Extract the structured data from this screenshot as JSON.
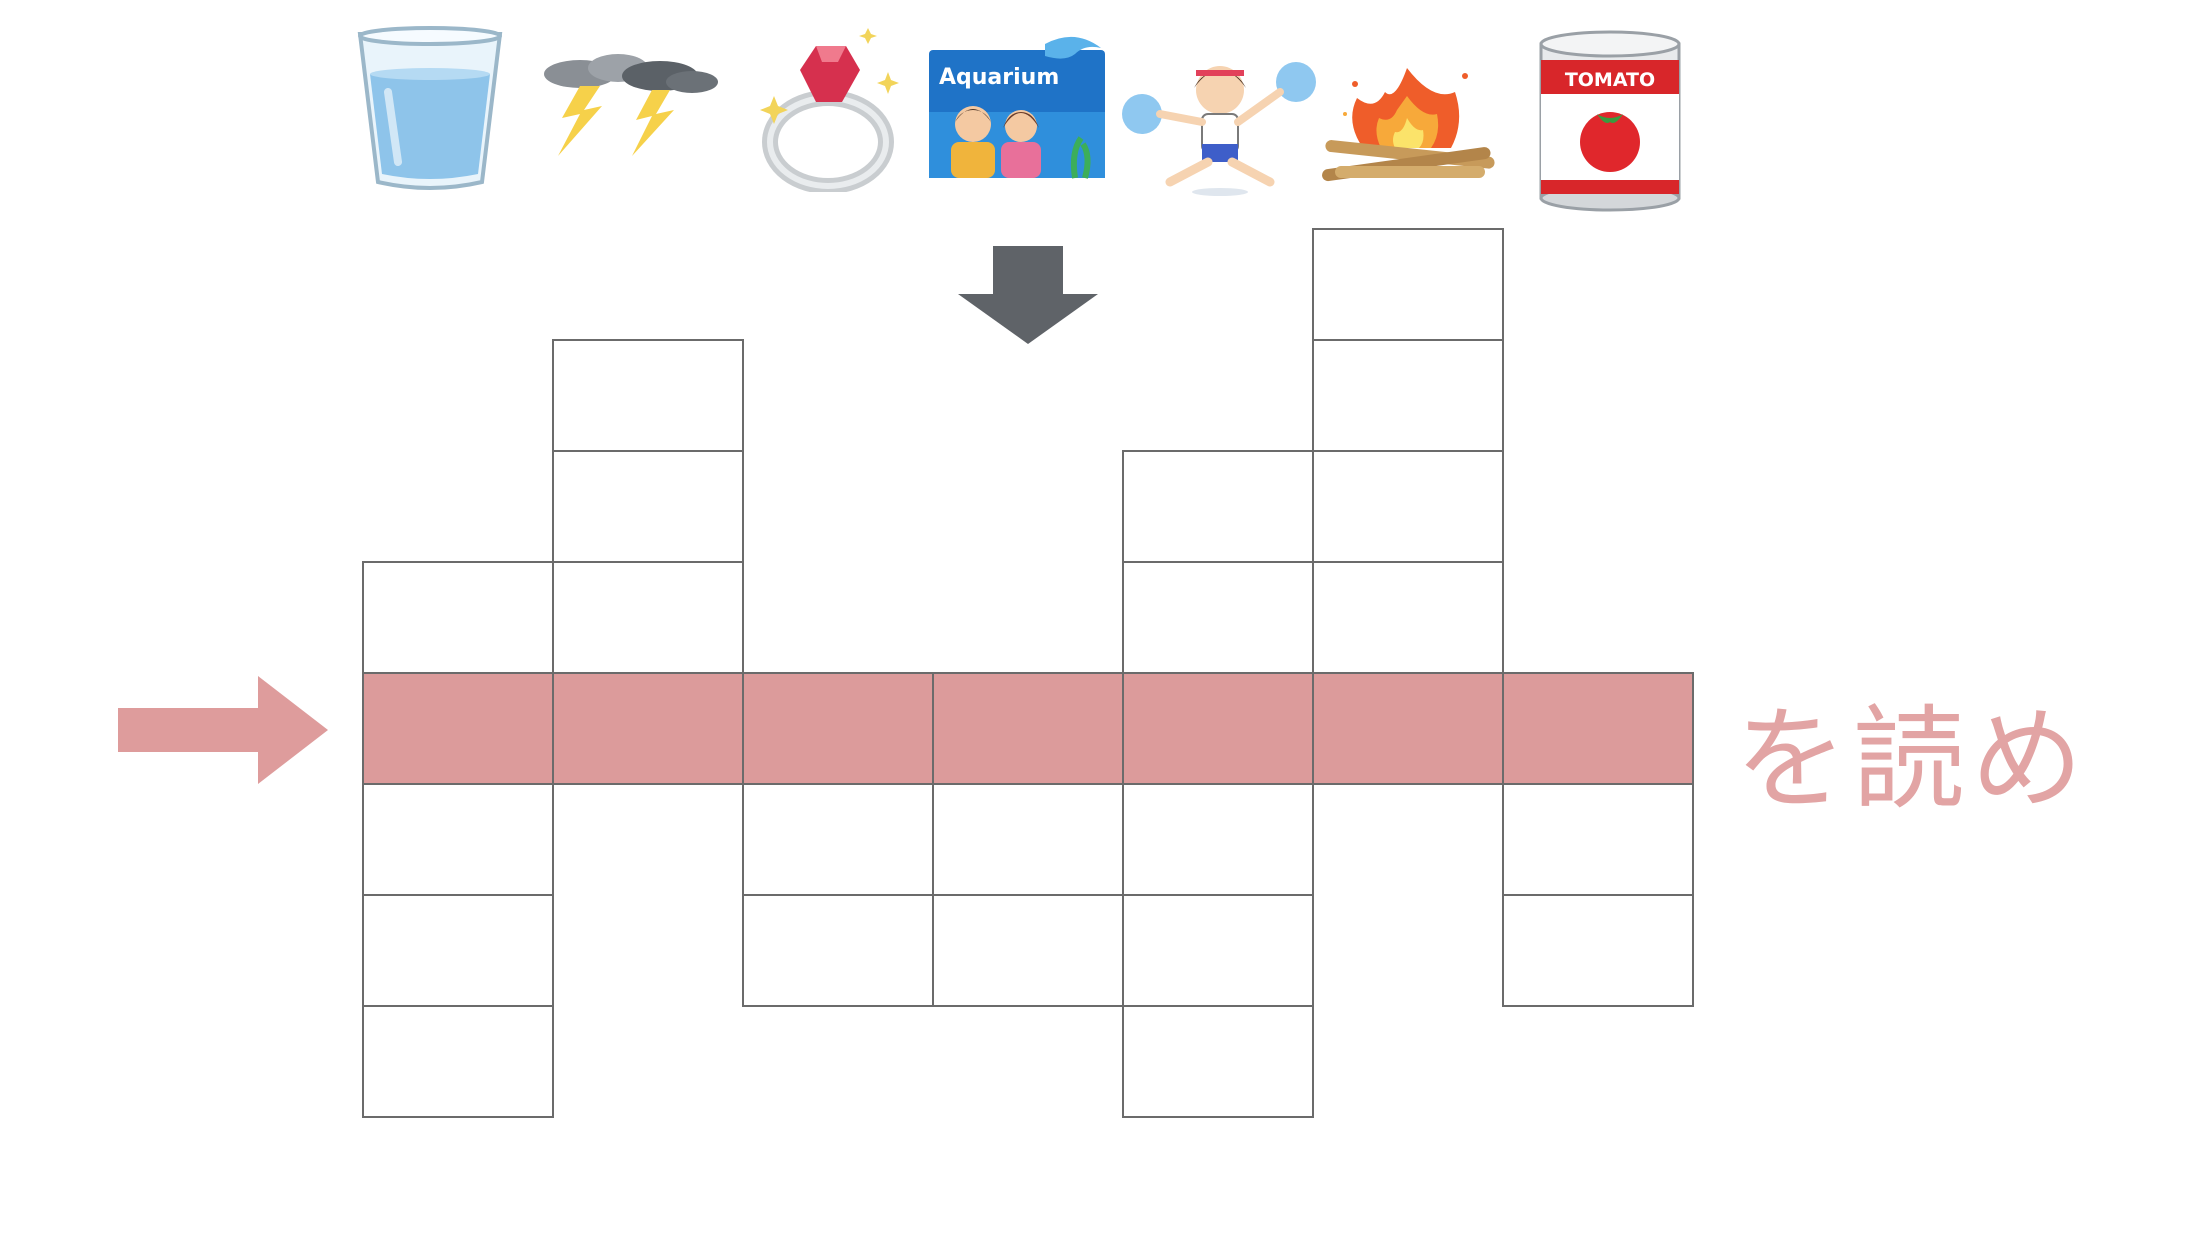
{
  "hints": [
    {
      "icon": "glass-of-water-icon"
    },
    {
      "icon": "thunderstorm-icon"
    },
    {
      "icon": "ruby-ring-icon"
    },
    {
      "icon": "aquarium-date-icon",
      "label": "Aquarium"
    },
    {
      "icon": "cheerleader-jump-icon"
    },
    {
      "icon": "bonfire-icon"
    },
    {
      "icon": "tomato-can-icon",
      "label": "TOMATO"
    }
  ],
  "puzzle": {
    "columns": [
      {
        "cells_above": 1,
        "cells_below": 3
      },
      {
        "cells_above": 3,
        "cells_below": 0
      },
      {
        "cells_above": 0,
        "cells_below": 2
      },
      {
        "cells_above": 0,
        "cells_below": 2
      },
      {
        "cells_above": 2,
        "cells_below": 3
      },
      {
        "cells_above": 4,
        "cells_below": 0
      },
      {
        "cells_above": 0,
        "cells_below": 2
      }
    ]
  },
  "instruction": "を読め",
  "colors": {
    "highlight": "#dc9b9b",
    "instruction_text": "#e2a4a4",
    "arrow_right": "#de9c9c",
    "arrow_down": "#5f6368",
    "cell_border": "#6b6b6b"
  }
}
